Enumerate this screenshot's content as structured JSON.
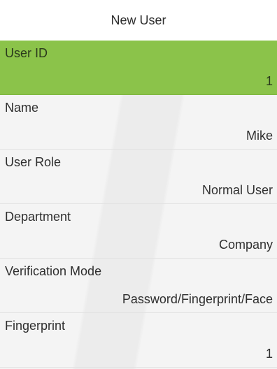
{
  "header": {
    "title": "New User"
  },
  "fields": [
    {
      "label": "User ID",
      "value": "1",
      "selected": true
    },
    {
      "label": "Name",
      "value": "Mike",
      "selected": false
    },
    {
      "label": "User Role",
      "value": "Normal User",
      "selected": false
    },
    {
      "label": "Department",
      "value": "Company",
      "selected": false
    },
    {
      "label": "Verification Mode",
      "value": "Password/Fingerprint/Face",
      "selected": false
    },
    {
      "label": "Fingerprint",
      "value": "1",
      "selected": false
    }
  ],
  "colors": {
    "selected_highlight": "#8bc34a",
    "background": "#f4f4f4",
    "title_background": "#ffffff"
  }
}
